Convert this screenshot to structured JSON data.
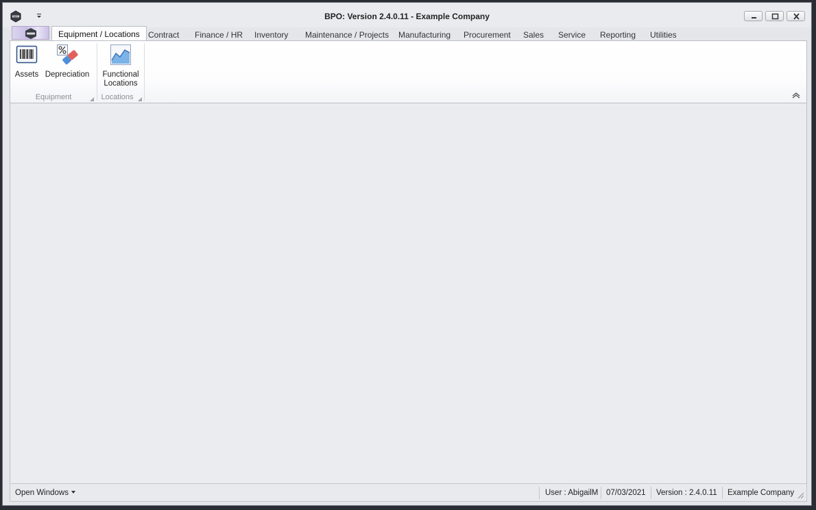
{
  "window": {
    "title": "BPO: Version 2.4.0.11 - Example Company",
    "app_icon": "bpo-logo-icon",
    "controls": [
      "minimize-icon",
      "restore-icon",
      "close-icon"
    ]
  },
  "ribbon": {
    "tabs": [
      {
        "label": "Equipment / Locations",
        "active": true
      },
      {
        "label": "Contract"
      },
      {
        "label": "Finance / HR"
      },
      {
        "label": "Inventory"
      },
      {
        "label": "Maintenance / Projects"
      },
      {
        "label": "Manufacturing"
      },
      {
        "label": "Procurement"
      },
      {
        "label": "Sales"
      },
      {
        "label": "Service"
      },
      {
        "label": "Reporting"
      },
      {
        "label": "Utilities"
      }
    ],
    "groups": [
      {
        "label": "Equipment",
        "buttons": [
          {
            "label": "Assets",
            "icon": "barcode-icon"
          },
          {
            "label": "Depreciation",
            "icon": "percent-eraser-icon"
          }
        ]
      },
      {
        "label": "Locations",
        "buttons": [
          {
            "label_line1": "Functional",
            "label_line2": "Locations",
            "icon": "area-chart-icon"
          }
        ]
      }
    ]
  },
  "status": {
    "open_windows": "Open Windows",
    "user": "User : AbigailM",
    "date": "07/03/2021",
    "version": "Version : 2.4.0.11",
    "company": "Example Company"
  }
}
